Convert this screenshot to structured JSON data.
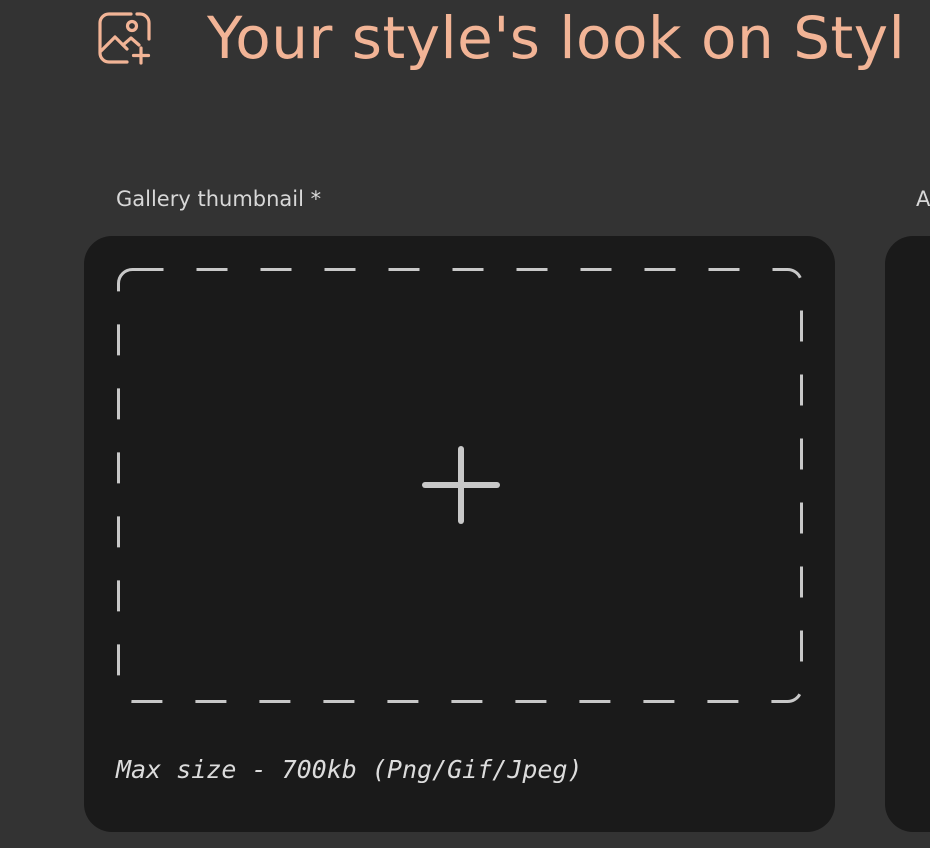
{
  "header": {
    "icon": "image-add-icon",
    "title": "Your style's look on Styl"
  },
  "thumbnail_field": {
    "label": "Gallery thumbnail *",
    "dropzone_icon": "plus-icon",
    "note": "Max size - 700kb (Png/Gif/Jpeg)"
  },
  "second_field": {
    "label": "A"
  },
  "colors": {
    "background": "#333333",
    "card": "#1a1a1a",
    "accent": "#f2b496",
    "dash": "#c8c8c8",
    "label_text": "#d8d8d8"
  }
}
